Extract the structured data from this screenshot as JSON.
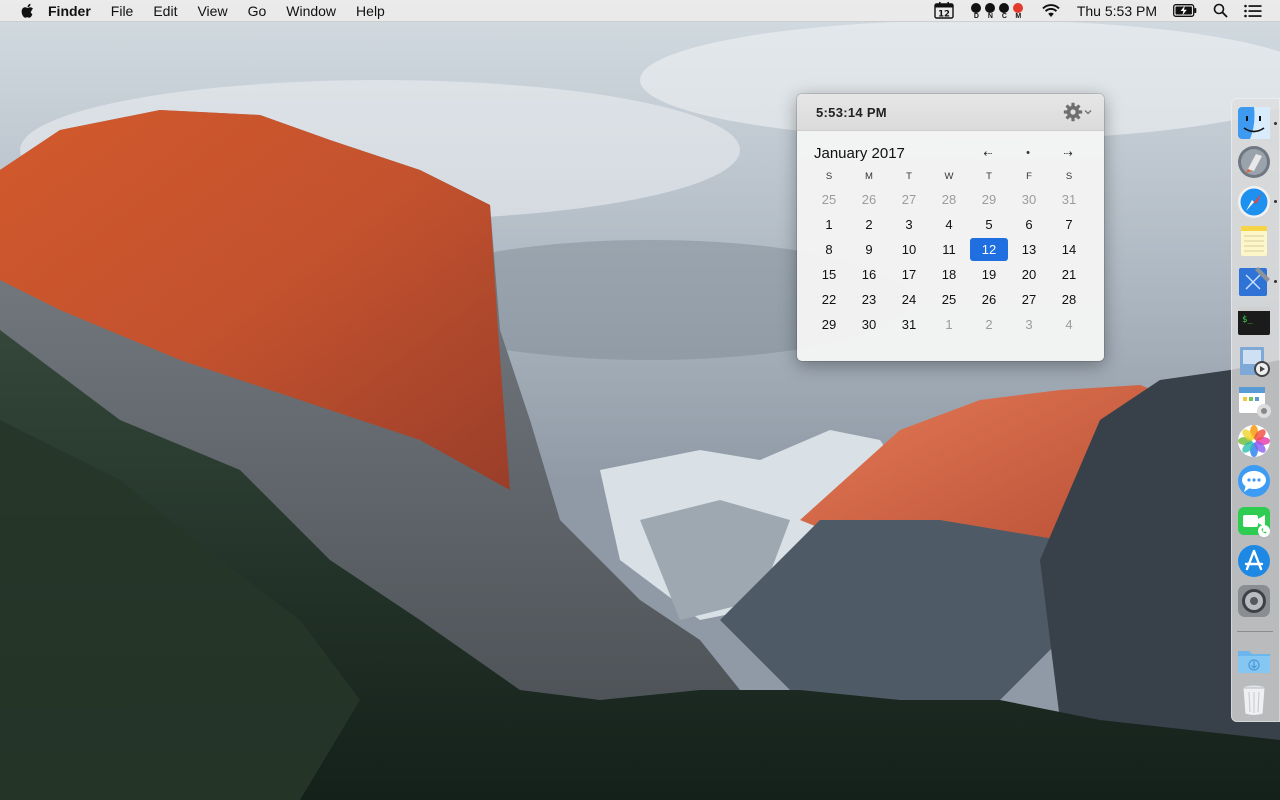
{
  "menubar": {
    "app_name": "Finder",
    "menus": [
      "File",
      "Edit",
      "View",
      "Go",
      "Window",
      "Help"
    ],
    "status_letters": [
      "D",
      "N",
      "C",
      "M"
    ],
    "clock": "Thu 5:53 PM"
  },
  "calendar": {
    "time": "5:53:14 PM",
    "month_title": "January 2017",
    "nav": {
      "prev": "⇠",
      "today": "•",
      "next": "⇢"
    },
    "weekdays": [
      "S",
      "M",
      "T",
      "W",
      "T",
      "F",
      "S"
    ],
    "weeks": [
      [
        "25",
        "26",
        "27",
        "28",
        "29",
        "30",
        "31"
      ],
      [
        "1",
        "2",
        "3",
        "4",
        "5",
        "6",
        "7"
      ],
      [
        "8",
        "9",
        "10",
        "11",
        "12",
        "13",
        "14"
      ],
      [
        "15",
        "16",
        "17",
        "18",
        "19",
        "20",
        "21"
      ],
      [
        "22",
        "23",
        "24",
        "25",
        "26",
        "27",
        "28"
      ],
      [
        "29",
        "30",
        "31",
        "1",
        "2",
        "3",
        "4"
      ]
    ],
    "today_label": "12",
    "accent_color": "#1f6fe0"
  },
  "dock": {
    "icons": [
      "finder-icon",
      "launchpad-icon",
      "safari-icon",
      "notes-icon",
      "xcode-icon",
      "terminal-icon",
      "preview-icon",
      "calendar-app-icon",
      "photos-icon",
      "messages-icon",
      "facetime-icon",
      "app-store-icon",
      "system-preferences-icon",
      "downloads-folder-icon",
      "trash-icon"
    ]
  }
}
